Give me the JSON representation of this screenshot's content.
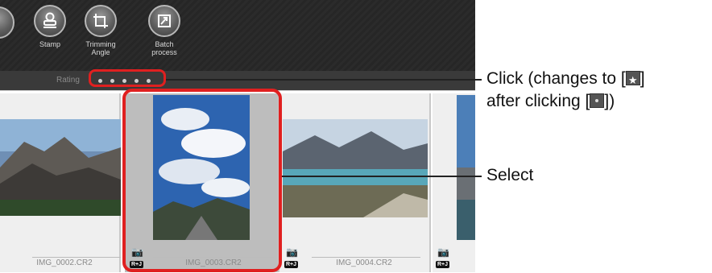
{
  "toolbar": {
    "buttons": [
      {
        "label": "Stamp"
      },
      {
        "label": "Trimming\nAngle"
      },
      {
        "label": "Batch\nprocess"
      }
    ]
  },
  "rating": {
    "label": "Rating",
    "dots": 5
  },
  "thumbnails": [
    {
      "filename": "IMG_0002.CR2",
      "badge": "R+J"
    },
    {
      "filename": "IMG_0003.CR2",
      "badge": "R+J"
    },
    {
      "filename": "IMG_0004.CR2",
      "badge": "R+J"
    },
    {
      "filename": "",
      "badge": "R+J"
    }
  ],
  "callouts": {
    "rating_line1": "Click (changes to [",
    "rating_line1_end": "]",
    "rating_line2": "after clicking [",
    "rating_line2_end": "])",
    "select": "Select"
  },
  "colors": {
    "highlight": "#e02020"
  }
}
